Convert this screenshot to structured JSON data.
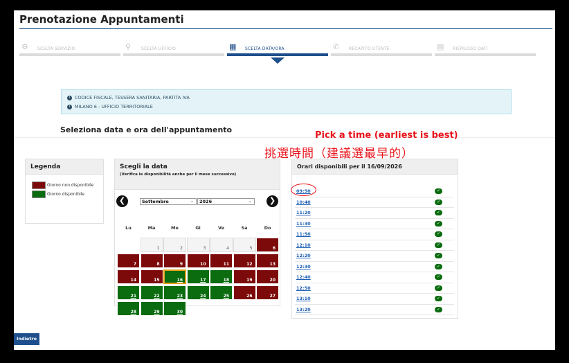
{
  "header": {
    "title": "Prenotazione Appuntamenti"
  },
  "steps": [
    {
      "label": "SCELTA SERVIZIO",
      "icon": "gears-icon",
      "glyph": "⚙",
      "active": false
    },
    {
      "label": "SCELTA UFFICIO",
      "icon": "map-pin-icon",
      "glyph": "⚲",
      "active": false
    },
    {
      "label": "SCELTA DATA/ORA",
      "icon": "calendar-icon",
      "glyph": "▦",
      "active": true
    },
    {
      "label": "RECAPITO UTENTE",
      "icon": "phone-icon",
      "glyph": "✆",
      "active": false
    },
    {
      "label": "RIEPILOGO DATI",
      "icon": "id-card-icon",
      "glyph": "▤",
      "active": false
    }
  ],
  "info": {
    "service": "CODICE FISCALE, TESSERA SANITARIA, PARTITA IVA",
    "office": "MILANO 6 - UFFICIO TERRITORIALE"
  },
  "section_title": "Seleziona data e ora dell'appuntamento",
  "annotation": {
    "english": "Pick a time (earliest is best)",
    "chinese": "挑選時間（建議選最早的）",
    "color": "#e8141c"
  },
  "legend": {
    "title": "Legenda",
    "items": [
      {
        "label": "Giorno non disponibile",
        "color": "#7d0a0a"
      },
      {
        "label": "Giorno disponibile",
        "color": "#0a6b0f"
      }
    ]
  },
  "calendar": {
    "title": "Scegli la data",
    "subtitle": "(Verifica le disponibilità anche per il mese successivo)",
    "month": "Settembre",
    "year": "2026",
    "prev_icon": "arrow-left-icon",
    "next_icon": "arrow-right-icon",
    "weekdays": [
      "Lu",
      "Ma",
      "Me",
      "Gi",
      "Ve",
      "Sa",
      "Do"
    ],
    "selected_day": "16",
    "weeks": [
      [
        {
          "d": "",
          "s": "none"
        },
        {
          "d": "1",
          "s": "empty"
        },
        {
          "d": "2",
          "s": "empty"
        },
        {
          "d": "3",
          "s": "empty"
        },
        {
          "d": "4",
          "s": "empty"
        },
        {
          "d": "5",
          "s": "empty"
        },
        {
          "d": "6",
          "s": "na"
        }
      ],
      [
        {
          "d": "7",
          "s": "na"
        },
        {
          "d": "8",
          "s": "na"
        },
        {
          "d": "9",
          "s": "na"
        },
        {
          "d": "10",
          "s": "na"
        },
        {
          "d": "11",
          "s": "na"
        },
        {
          "d": "12",
          "s": "na"
        },
        {
          "d": "13",
          "s": "na"
        }
      ],
      [
        {
          "d": "14",
          "s": "na"
        },
        {
          "d": "15",
          "s": "na"
        },
        {
          "d": "16",
          "s": "av"
        },
        {
          "d": "17",
          "s": "av"
        },
        {
          "d": "18",
          "s": "av"
        },
        {
          "d": "19",
          "s": "na"
        },
        {
          "d": "20",
          "s": "na"
        }
      ],
      [
        {
          "d": "21",
          "s": "av"
        },
        {
          "d": "22",
          "s": "av"
        },
        {
          "d": "23",
          "s": "av"
        },
        {
          "d": "24",
          "s": "av"
        },
        {
          "d": "25",
          "s": "av"
        },
        {
          "d": "26",
          "s": "na"
        },
        {
          "d": "27",
          "s": "na"
        }
      ],
      [
        {
          "d": "28",
          "s": "av"
        },
        {
          "d": "29",
          "s": "av"
        },
        {
          "d": "30",
          "s": "av"
        }
      ]
    ]
  },
  "times": {
    "title": "Orari disponibili per il 16/09/2026",
    "check_icon": "check-icon",
    "slots": [
      "09:50",
      "10:40",
      "11:20",
      "11:30",
      "11:50",
      "12:10",
      "12:20",
      "12:30",
      "12:40",
      "12:50",
      "13:10",
      "13:20"
    ]
  },
  "footer": {
    "back_label": "Indietro"
  }
}
